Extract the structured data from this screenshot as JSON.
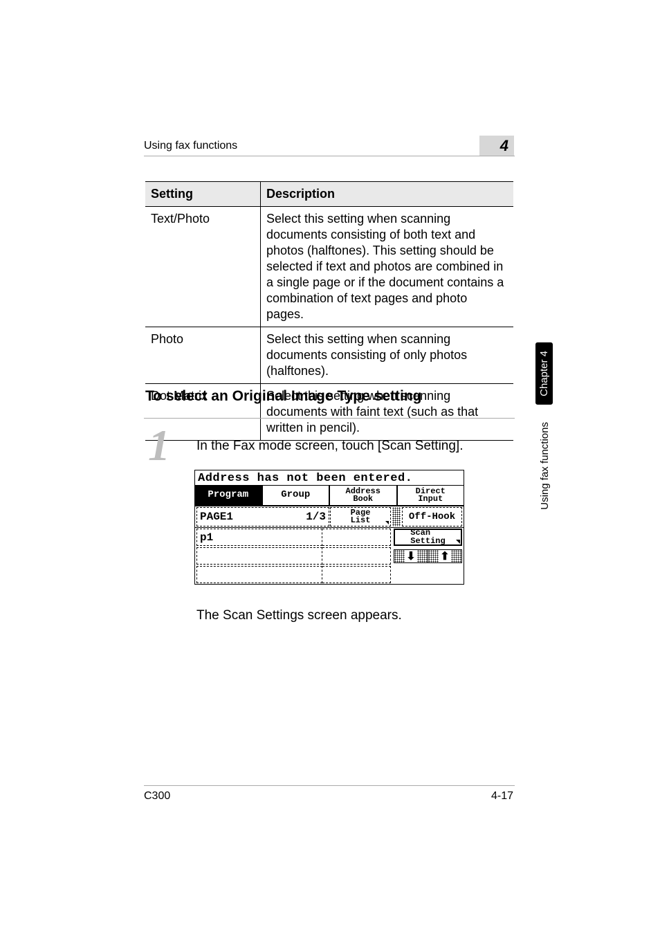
{
  "header": {
    "title": "Using fax functions",
    "page_marker": "4"
  },
  "side": {
    "chapter": "Chapter 4",
    "section": "Using fax functions"
  },
  "table": {
    "head": {
      "c1": "Setting",
      "c2": "Description"
    },
    "rows": [
      {
        "c1": "Text/Photo",
        "c2": "Select this setting when scanning documents consisting of both text and photos (halftones). This setting should be selected if text and photos are combined in a single page or if the document contains a combination of text pages and photo pages."
      },
      {
        "c1": "Photo",
        "c2": "Select this setting when scanning documents consisting of only photos (halftones)."
      },
      {
        "c1": "Dot Matrix",
        "c2": "Select this setting when scanning documents with faint text (such as that written in pencil)."
      }
    ]
  },
  "section_heading": "To select an Original Image Type setting",
  "step": {
    "num": "1",
    "text": "In the Fax mode screen, touch [Scan Setting].",
    "followup": "The Scan Settings screen appears."
  },
  "lcd": {
    "status": "Address has not been entered.",
    "tabs": {
      "program": "Program",
      "group": "Group",
      "address_book": "Address\nBook",
      "direct_input": "Direct\nInput"
    },
    "page_label": "PAGE1",
    "page_count": "1/3",
    "page_list": "Page\nList",
    "off_hook": "Off-Hook",
    "row1": "p1",
    "scan_setting": "Scan\nSetting",
    "arrows": {
      "down": "⬇",
      "up": "⬆"
    }
  },
  "footer": {
    "left": "C300",
    "right": "4-17"
  }
}
